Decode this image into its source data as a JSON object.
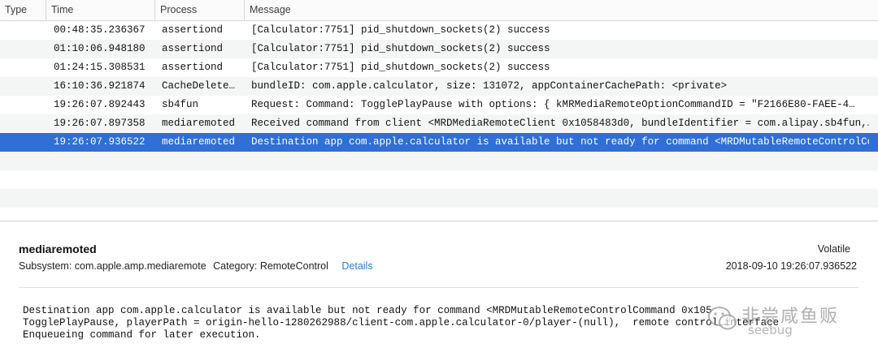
{
  "header": {
    "type_label": "Type",
    "time_label": "Time",
    "process_label": "Process",
    "message_label": "Message"
  },
  "rows": [
    {
      "time": "00:48:35.236367",
      "process": "assertiond",
      "message": "[Calculator:7751] pid_shutdown_sockets(2) success"
    },
    {
      "time": "01:10:06.948180",
      "process": "assertiond",
      "message": "[Calculator:7751] pid_shutdown_sockets(2) success"
    },
    {
      "time": "01:24:15.308531",
      "process": "assertiond",
      "message": "[Calculator:7751] pid_shutdown_sockets(2) success"
    },
    {
      "time": "16:10:36.921874",
      "process": "CacheDelete…",
      "message": "bundleID: com.apple.calculator, size: 131072, appContainerCachePath: <private>"
    },
    {
      "time": "19:26:07.892443",
      "process": "sb4fun",
      "message": "Request: Command: TogglePlayPause with options: {     kMRMediaRemoteOptionCommandID = \"F2166E80-FAEE-4…"
    },
    {
      "time": "19:26:07.897358",
      "process": "mediaremoted",
      "message": "Received command from client <MRDMediaRemoteClient 0x1058483d0, bundleIdentifier = com.alipay.sb4fun,…"
    },
    {
      "time": "19:26:07.936522",
      "process": "mediaremoted",
      "message": "Destination app com.apple.calculator is available but not ready for command <MRDMutableRemoteControlCo…"
    }
  ],
  "detail": {
    "title": "mediaremoted",
    "volatile": "Volatile",
    "subsystem": "Subsystem: com.apple.amp.mediaremote",
    "category": "Category: RemoteControl",
    "details_link": "Details",
    "timestamp": "2018-09-10 19:26:07.936522",
    "message_line1": "Destination app com.apple.calculator is available but not ready for command <MRDMutableRemoteControlCommand 0x105",
    "message_line2": "TogglePlayPause, playerPath = origin-hello-1280262988/client-com.apple.calculator-0/player-(null),  remote control interface",
    "message_line3": "Enqueueing command for later execution."
  },
  "watermark": {
    "text": "非尝咸鱼贩",
    "sub": "seebug"
  },
  "colors": {
    "selection": "#2f6fd6",
    "link": "#2e7cd6",
    "alt_row": "#f4f5f5"
  }
}
